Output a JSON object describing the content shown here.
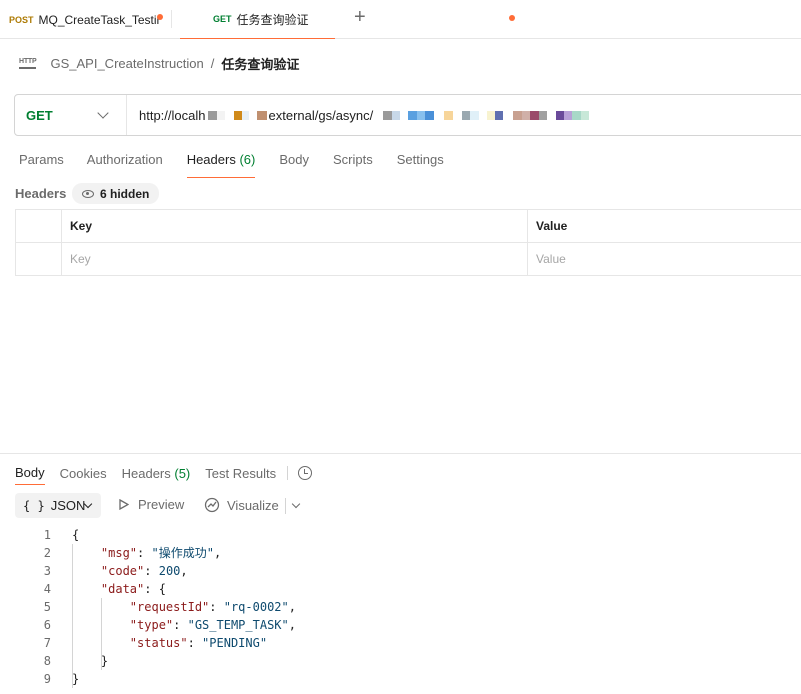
{
  "tabs": [
    {
      "method": "POST",
      "label": "MQ_CreateTask_Testir",
      "unsaved": true
    },
    {
      "method": "GET",
      "label": "任务查询验证",
      "unsaved": true,
      "active": true
    }
  ],
  "breadcrumb": {
    "icon_text": "HTTP",
    "parent": "GS_API_CreateInstruction",
    "separator": "/",
    "current": "任务查询验证"
  },
  "request": {
    "method": "GET",
    "url_prefix": "http://localh",
    "url_middle": "external/gs/async/"
  },
  "request_tabs": [
    {
      "label": "Params",
      "count": ""
    },
    {
      "label": "Authorization",
      "count": ""
    },
    {
      "label": "Headers",
      "count": "(6)",
      "active": true
    },
    {
      "label": "Body",
      "count": ""
    },
    {
      "label": "Scripts",
      "count": ""
    },
    {
      "label": "Settings",
      "count": ""
    }
  ],
  "headers_section": {
    "label": "Headers",
    "hidden_badge": "6 hidden",
    "columns": {
      "key": "Key",
      "value": "Value"
    },
    "placeholder": {
      "key": "Key",
      "value": "Value"
    }
  },
  "response_tabs": [
    {
      "label": "Body",
      "count": "",
      "active": true
    },
    {
      "label": "Cookies",
      "count": ""
    },
    {
      "label": "Headers",
      "count": "(5)"
    },
    {
      "label": "Test Results",
      "count": ""
    }
  ],
  "response_toolbar": {
    "format_icon": "{ }",
    "format": "JSON",
    "preview": "Preview",
    "visualize": "Visualize"
  },
  "response_body": {
    "line_numbers": [
      "1",
      "2",
      "3",
      "4",
      "5",
      "6",
      "7",
      "8",
      "9"
    ],
    "msg_key": "\"msg\"",
    "msg_value": "\"操作成功\"",
    "code_key": "\"code\"",
    "code_value": "200",
    "data_key": "\"data\"",
    "requestId_key": "\"requestId\"",
    "requestId_value": "\"rq-0002\"",
    "type_key": "\"type\"",
    "type_value": "\"GS_TEMP_TASK\"",
    "status_key": "\"status\"",
    "status_value": "\"PENDING\""
  },
  "colors": {
    "accent": "#ff6c37",
    "get_method": "#007f31",
    "post_method": "#ad7a03",
    "json_key": "#8b1a1a",
    "json_value": "#0e4a6e"
  },
  "icons": [
    "plus-icon",
    "http-icon",
    "chevron-down-icon",
    "eye-icon",
    "history-icon",
    "preview-icon",
    "visualize-icon"
  ]
}
